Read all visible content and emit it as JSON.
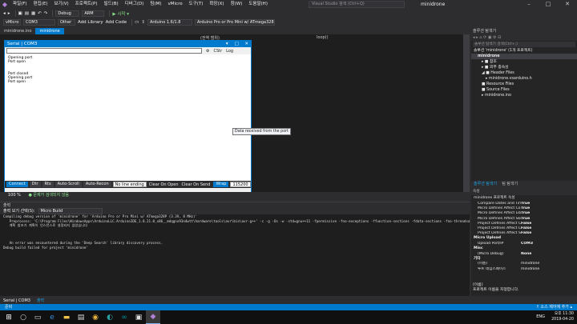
{
  "menu": {
    "items": [
      "파일(F)",
      "편집(E)",
      "보기(V)",
      "프로젝트(P)",
      "빌드(B)",
      "디버그(D)",
      "팀(M)",
      "vMicro",
      "도구(T)",
      "확장(X)",
      "창(W)",
      "도움말(H)"
    ],
    "search_placeholder": "Visual Studio 검색 (Ctrl+Q)",
    "app_title": "minidrone",
    "live_share": "Live Share"
  },
  "toolbar": {
    "config": "Debug",
    "platform": "ARM",
    "start": "▶ 시작 ▾",
    "vmicro": "vMicro",
    "port": "COM3",
    "other": "Other",
    "add_library": "Add Library",
    "add_code": "Add Code",
    "ide": "Arduino 1.6/1.8",
    "board": "Arduino Pro or Pro Mini w/ ATmega328"
  },
  "doc_tabs": [
    "minidrone.ino",
    "minidrone"
  ],
  "serial": {
    "title": "Serial | COM3",
    "clear_label": "CStr",
    "log_label": "Log",
    "output_lines": [
      "Opening port",
      "Port open",
      "",
      "",
      "Port closed",
      "Opening port",
      "Port open"
    ],
    "buttons": [
      "Connect",
      "Dtr",
      "Rts",
      "Auto-Scroll",
      "Auto-Recon"
    ],
    "line_ending": "No line ending",
    "clear_on_open": "Clear On Open",
    "clear_on_send": "Clear On Send",
    "wrap": "Wrap",
    "baud": "115200"
  },
  "tooltip": "Data received from the port",
  "editor": {
    "loop_label": "loop()",
    "scope_label": "(전역 범위)"
  },
  "zoom": {
    "level": "100 %",
    "issues": "● 문제가 검색되지 않음"
  },
  "output": {
    "header": "출력",
    "source_label": "출력 보기 선택(S):",
    "source_value": "Micro Build",
    "lines": [
      "Compiling debug version of 'minidrone' for 'Arduino Pro or Pro Mini w/ ATmega328P (3.3V, 8 MHz)'",
      "   Preprocess: 'C:\\Program Files\\WindowsApps\\ArduinoLLC.ArduinoIDE_1.8.21.0_x86__mdqgnx93n4wtt\\hardware\\tools\\avr\\bin\\avr-g++' -c -g -Os -w -std=gnu++11 -fpermissive -fno-exceptions -ffunction-sections -fdata-sections -fno-threadsafe-statics -flto -w",
      "   계획 참조가 계획이 인스턴스로 설정되지 않았습니다",
      "",
      "",
      "",
      "   An error was encountered during the 'Deep Search' library discovery process.",
      "Debug build failed for project 'minidrone'"
    ],
    "bottom_tabs": [
      "Serial | COM3",
      "출력"
    ]
  },
  "solution": {
    "header": "솔루션 탐색기",
    "search": "솔루션 탐색기 검색(Ctrl+;)",
    "items": [
      {
        "label": "솔루션 'minidrone' (1개 프로젝트)",
        "indent": 0
      },
      {
        "label": "minidrone",
        "indent": 1
      },
      {
        "label": "▸ ■ 참조",
        "indent": 2
      },
      {
        "label": "▸ ■ 외부 종속성",
        "indent": 2
      },
      {
        "label": "◢ ■ Header Files",
        "indent": 2
      },
      {
        "label": "▸ minidrone.vsarduino.h",
        "indent": 3
      },
      {
        "label": "■ Resource Files",
        "indent": 2
      },
      {
        "label": "■ Source Files",
        "indent": 2
      },
      {
        "label": "▸ minidrone.ino",
        "indent": 2
      }
    ],
    "tabs": [
      "솔루션 탐색기",
      "팀 탐색기"
    ]
  },
  "properties": {
    "header": "속성",
    "object": "minidrone 프로젝트 속성",
    "rows": [
      {
        "k": "Compare Dates and Times",
        "v": "True"
      },
      {
        "k": "Micro Defines Affect Core",
        "v": "True"
      },
      {
        "k": "Micro Defines Affect Libs",
        "v": "True"
      },
      {
        "k": "Micro Defines Affect Sketch",
        "v": "True"
      },
      {
        "k": "Project Defines Affect Core",
        "v": "False"
      },
      {
        "k": "Project Defines Affect Libs",
        "v": "False"
      },
      {
        "k": "Project Defines Affect Sketch",
        "v": "False"
      }
    ],
    "cat1": "Micro Upload",
    "row_upload": {
      "k": "Upload Port/IP",
      "v": "COM3"
    },
    "cat2": "Misc",
    "row_misc": {
      "k": "(Micro Debug)",
      "v": "None"
    },
    "cat3": "기타",
    "row_name": {
      "k": "(이름)",
      "v": "minidrone"
    },
    "row_ns": {
      "k": "루트 네임스페이스",
      "v": "minidrone"
    },
    "desc_title": "(이름)",
    "desc": "프로젝트 이름을 지정합니다."
  },
  "status": {
    "left": "준비",
    "right": "↑ 소스 제어에 추가 ▴"
  },
  "taskbar": {
    "ime": "ENG",
    "time": "오후 11:30",
    "date": "2019-04-20"
  }
}
